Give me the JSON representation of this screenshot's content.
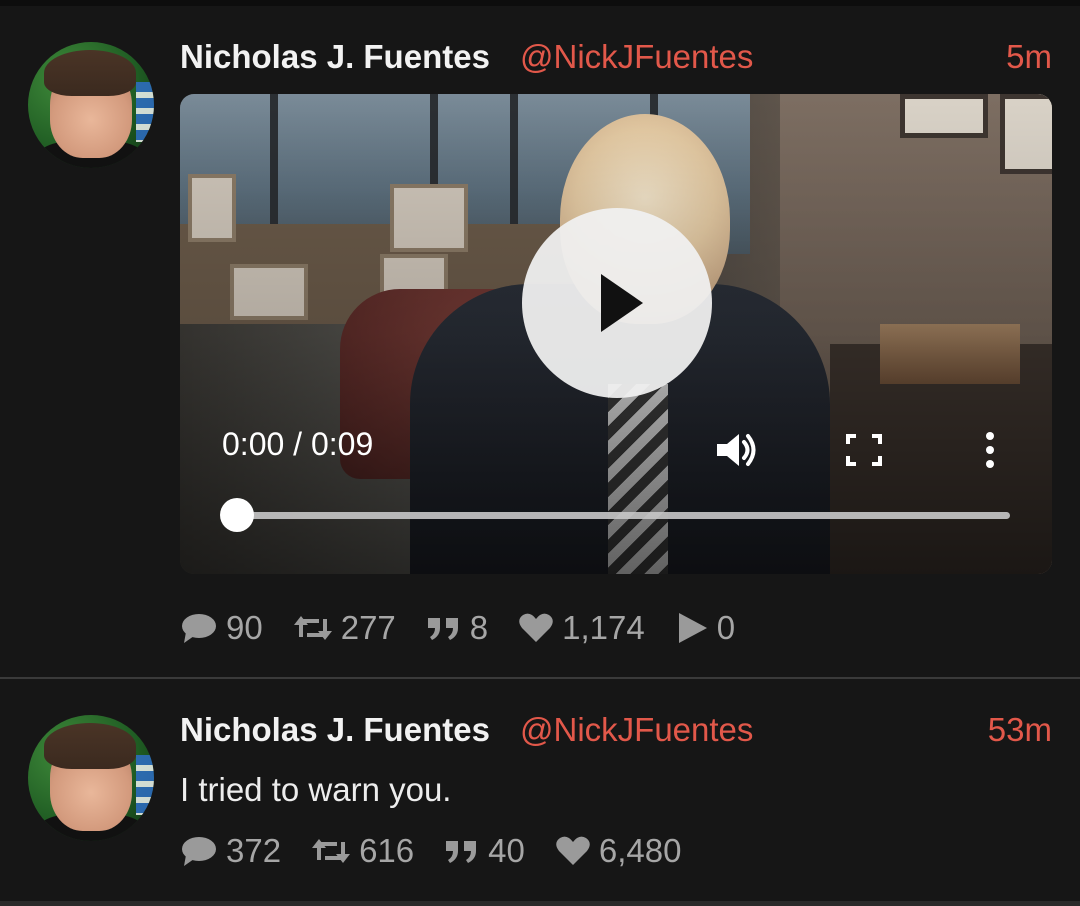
{
  "tweets": [
    {
      "author": "Nicholas J. Fuentes",
      "handle": "@NickJFuentes",
      "time": "5m",
      "video": {
        "time_display": "0:00 / 0:09",
        "progress": 0
      },
      "stats": {
        "replies": "90",
        "retweets": "277",
        "quotes": "8",
        "likes": "1,174",
        "plays": "0"
      }
    },
    {
      "author": "Nicholas J. Fuentes",
      "handle": "@NickJFuentes",
      "time": "53m",
      "text": "I tried to warn you.",
      "stats": {
        "replies": "372",
        "retweets": "616",
        "quotes": "40",
        "likes": "6,480"
      }
    }
  ],
  "colors": {
    "background": "#161616",
    "accent": "#e2584a",
    "muted": "#9a9a9a"
  },
  "icons": [
    "comment-icon",
    "retweet-icon",
    "quote-icon",
    "heart-icon",
    "play-icon",
    "volume-icon",
    "fullscreen-icon",
    "more-vert-icon"
  ]
}
